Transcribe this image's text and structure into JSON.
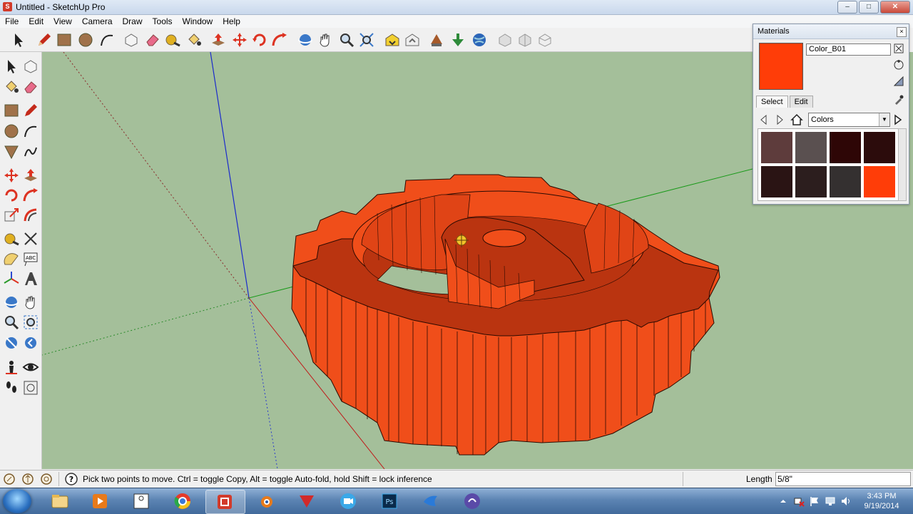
{
  "window": {
    "title": "Untitled - SketchUp Pro",
    "buttons": [
      "minimize",
      "maximize",
      "close"
    ]
  },
  "menu": [
    "File",
    "Edit",
    "View",
    "Camera",
    "Draw",
    "Tools",
    "Window",
    "Help"
  ],
  "toolbar": {
    "top": [
      "select-icon",
      "pencil-icon",
      "rectangle-icon",
      "circle-icon",
      "arc-icon",
      "make-component-icon",
      "eraser-icon",
      "tape-measure-icon",
      "paint-bucket-icon",
      "push-pull-icon",
      "move-icon",
      "rotate-icon",
      "follow-me-icon",
      "orbit-icon",
      "pan-icon",
      "zoom-icon",
      "zoom-extents-icon",
      "warehouse-icon",
      "share-model-icon",
      "get-models-icon",
      "extension-icon",
      "google-earth-icon",
      "component-a-icon",
      "component-b-icon",
      "component-c-icon"
    ],
    "left": [
      "select-icon",
      "make-component-icon",
      "paint-bucket-icon",
      "eraser-icon",
      "rectangle-icon",
      "line-icon",
      "circle-icon",
      "arc-icon",
      "polygon-icon",
      "freehand-icon",
      "move-icon",
      "push-pull-icon",
      "rotate-icon",
      "follow-me-icon",
      "scale-icon",
      "offset-icon",
      "tape-measure-icon",
      "dimension-icon",
      "protractor-icon",
      "text-icon",
      "axes-icon",
      "3d-text-icon",
      "orbit-icon",
      "pan-icon",
      "zoom-icon",
      "zoom-window-icon",
      "zoom-extents-icon",
      "previous-view-icon",
      "position-camera-icon",
      "look-around-icon",
      "walk-icon",
      "section-plane-icon"
    ]
  },
  "materials": {
    "title": "Materials",
    "name": "Color_B01",
    "current_color": "#ff3d08",
    "tabs": [
      "Select",
      "Edit"
    ],
    "library": "Colors",
    "swatches": [
      "#5e3c3c",
      "#5a5050",
      "#2e0606",
      "#2c0c0c",
      "#2a1414",
      "#2c1e1e",
      "#343030",
      "#ff3d08"
    ]
  },
  "status": {
    "message": "Pick two points to move.  Ctrl = toggle Copy, Alt = toggle Auto-fold, hold Shift = lock inference",
    "length_label": "Length",
    "length_value": "5/8\""
  },
  "taskbar": {
    "apps": [
      "explorer-icon",
      "media-player-icon",
      "puzzle-icon",
      "chrome-icon",
      "sketchup-icon",
      "blender-icon",
      "red-app-icon",
      "video-call-icon",
      "photoshop-icon",
      "bird-app-icon",
      "torrent-icon"
    ],
    "time": "3:43 PM",
    "date": "9/19/2014"
  },
  "colors": {
    "viewport": "#a4bf9a",
    "gear_top": "#ba3410",
    "gear_side": "#f04e1a"
  }
}
